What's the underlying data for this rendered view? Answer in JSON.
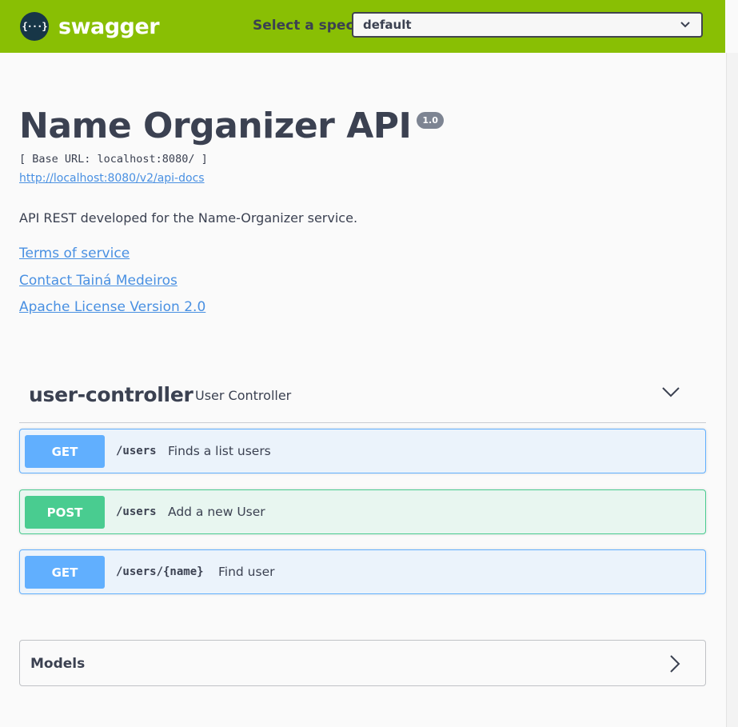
{
  "topbar": {
    "logo_text": "swagger",
    "logo_glyph": "{···}",
    "spec_label": "Select a spec",
    "spec_selected": "default"
  },
  "info": {
    "title": "Name Organizer API",
    "version": "1.0",
    "base_url": "[ Base URL: localhost:8080/ ]",
    "api_docs_link": "http://localhost:8080/v2/api-docs",
    "description": "API REST developed for the Name-Organizer service.",
    "links": {
      "terms": "Terms of service",
      "contact": "Contact Tainá Medeiros",
      "license": "Apache License Version 2.0"
    }
  },
  "controller": {
    "name": "user-controller",
    "description": "User Controller",
    "operations": [
      {
        "method": "GET",
        "path": "/users",
        "summary": "Finds a list users"
      },
      {
        "method": "POST",
        "path": "/users",
        "summary": "Add a new User"
      },
      {
        "method": "GET",
        "path": "/users/{name}",
        "summary": "Find user"
      }
    ]
  },
  "models": {
    "title": "Models"
  },
  "colors": {
    "topbar": "#89bf04",
    "get": "#61affe",
    "post": "#49cc90",
    "link": "#4990e2",
    "text": "#3b4151"
  },
  "icons": {
    "logo": "swagger-logo-icon",
    "select": "chevron-down-icon",
    "tag_toggle": "chevron-down-icon",
    "models_toggle": "chevron-right-icon"
  }
}
